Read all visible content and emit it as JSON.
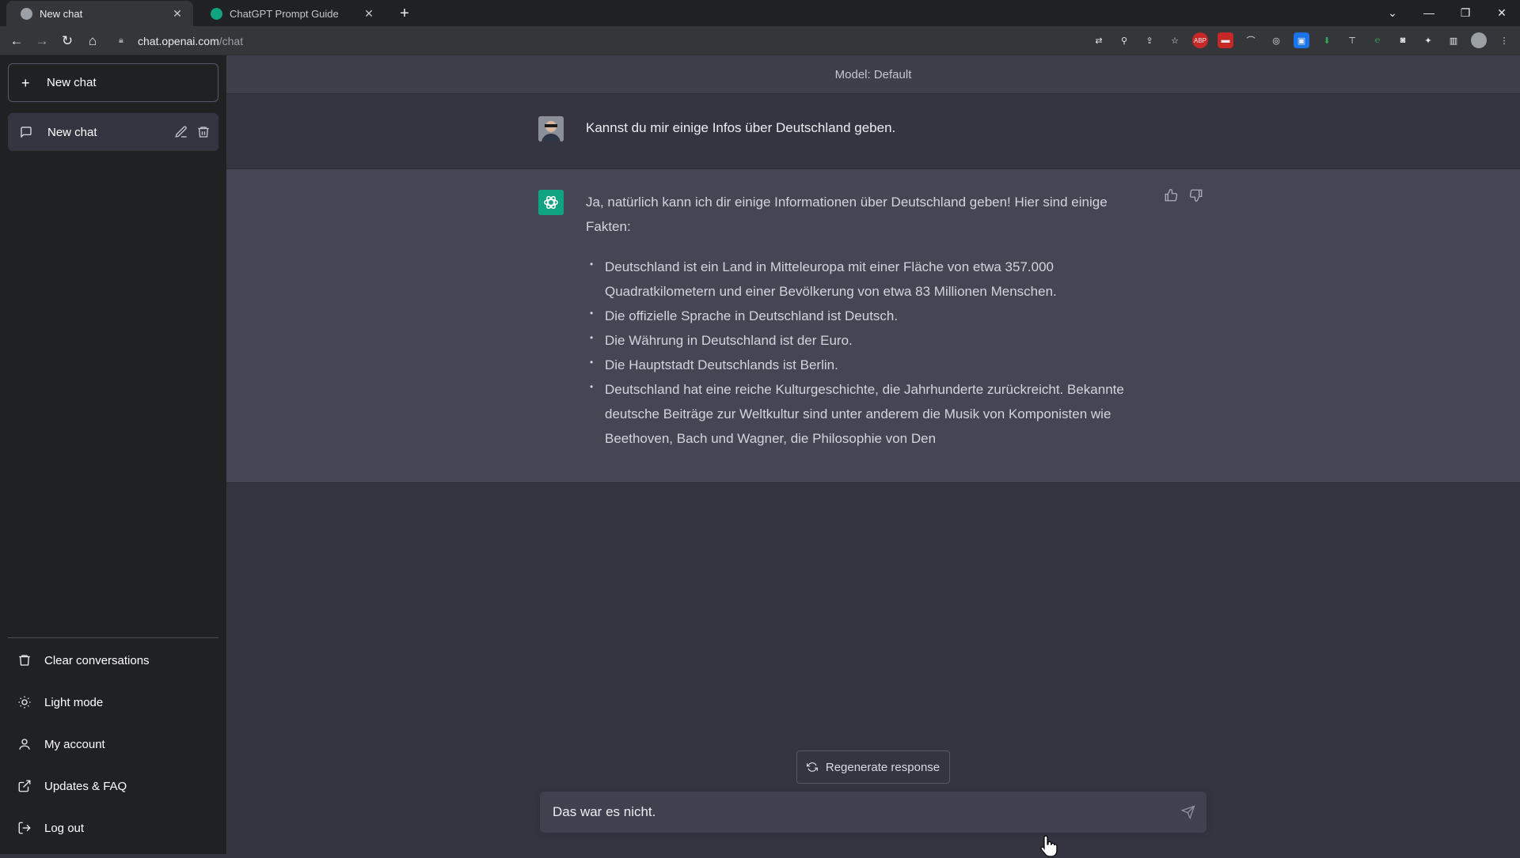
{
  "browser": {
    "tabs": [
      {
        "label": "New chat",
        "active": true
      },
      {
        "label": "ChatGPT Prompt Guide",
        "active": false
      }
    ],
    "url": {
      "domain": "chat.openai.com",
      "path": "/chat"
    }
  },
  "sidebar": {
    "new_chat_label": "New chat",
    "chats": [
      {
        "label": "New chat"
      }
    ],
    "menu": [
      {
        "label": "Clear conversations",
        "icon": "trash-icon"
      },
      {
        "label": "Light mode",
        "icon": "sun-icon"
      },
      {
        "label": "My account",
        "icon": "user-icon"
      },
      {
        "label": "Updates & FAQ",
        "icon": "external-link-icon"
      },
      {
        "label": "Log out",
        "icon": "logout-icon"
      }
    ]
  },
  "main": {
    "model_label": "Model: Default",
    "user_message": "Kannst du mir einige Infos über Deutschland geben.",
    "assistant": {
      "intro": "Ja, natürlich kann ich dir einige Informationen über Deutschland geben! Hier sind einige Fakten:",
      "bullets": [
        "Deutschland ist ein Land in Mitteleuropa mit einer Fläche von etwa 357.000 Quadratkilometern und einer Bevölkerung von etwa 83 Millionen Menschen.",
        "Die offizielle Sprache in Deutschland ist Deutsch.",
        "Die Währung in Deutschland ist der Euro.",
        "Die Hauptstadt Deutschlands ist Berlin.",
        "Deutschland hat eine reiche Kulturgeschichte, die Jahrhunderte zurückreicht. Bekannte deutsche Beiträge zur Weltkultur sind unter anderem die Musik von Komponisten wie Beethoven, Bach und Wagner, die Philosophie von Den"
      ]
    },
    "regenerate_label": "Regenerate response",
    "composer_value": "Das war es nicht."
  },
  "colors": {
    "accent": "#10a37f",
    "sidebar_bg": "#202123",
    "main_bg": "#343541",
    "assistant_bg": "#444654"
  }
}
